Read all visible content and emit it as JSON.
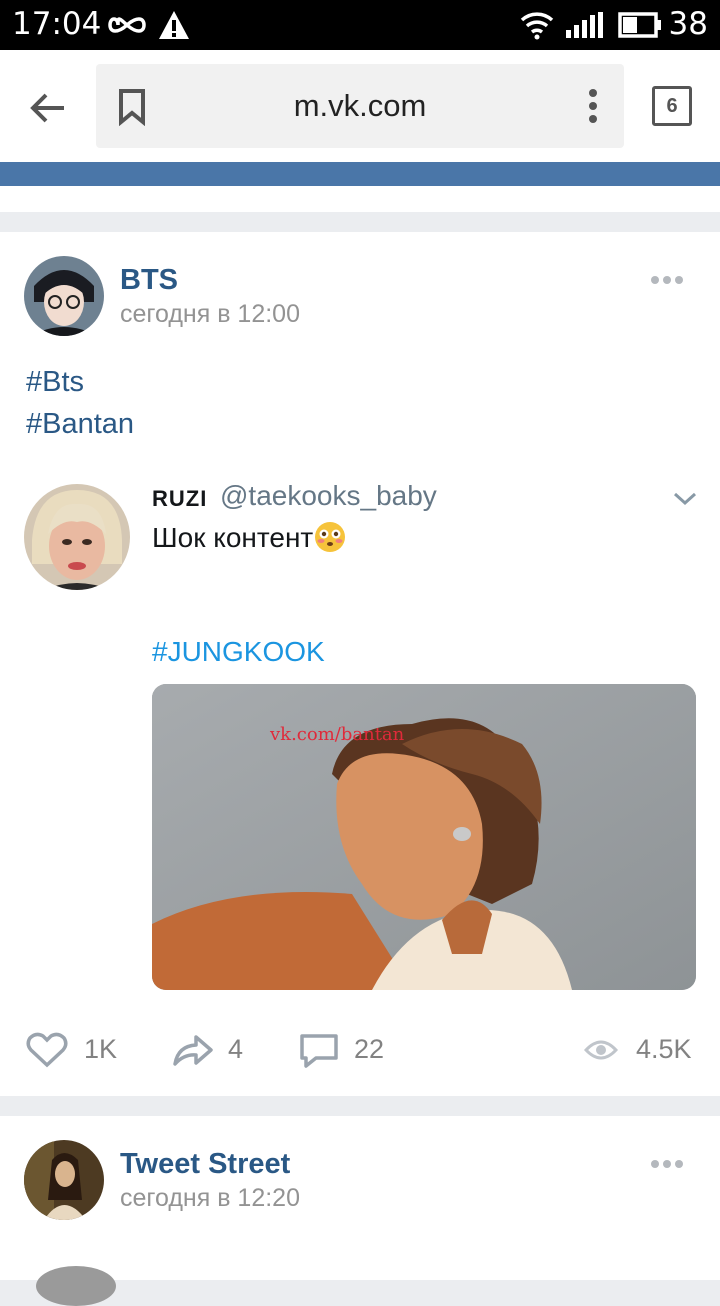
{
  "status_bar": {
    "time": "17:04",
    "battery": "38"
  },
  "browser": {
    "url": "m.vk.com",
    "tab_count": "6"
  },
  "posts": [
    {
      "author": "BTS",
      "time": "сегодня в 12:00",
      "hashtags": [
        "#Bts",
        "#Bantan"
      ],
      "tweet": {
        "name": "RUZI",
        "handle": "@taekooks_baby",
        "text": "Шок контент",
        "hashtag": "#JUNGKOOK",
        "watermark": "vk.com/bantan"
      },
      "stats": {
        "likes": "1K",
        "shares": "4",
        "comments": "22",
        "views": "4.5K"
      }
    },
    {
      "author": "Tweet Street",
      "time": "сегодня в 12:20"
    }
  ],
  "colors": {
    "vk_blue": "#4a76a8",
    "link": "#2a5885",
    "twitter_blue": "#1b95e0"
  }
}
